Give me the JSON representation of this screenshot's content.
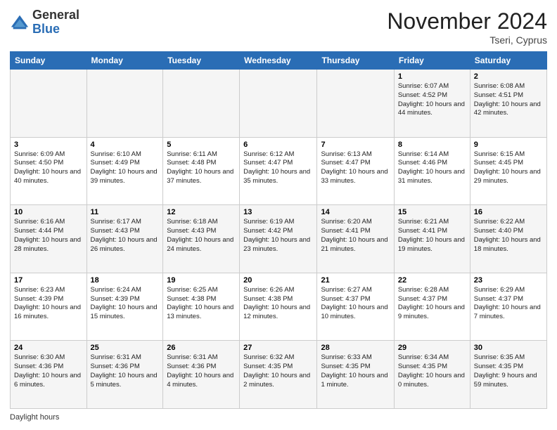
{
  "logo": {
    "general": "General",
    "blue": "Blue"
  },
  "header": {
    "month_year": "November 2024",
    "location": "Tseri, Cyprus"
  },
  "days_of_week": [
    "Sunday",
    "Monday",
    "Tuesday",
    "Wednesday",
    "Thursday",
    "Friday",
    "Saturday"
  ],
  "footer": {
    "daylight_label": "Daylight hours"
  },
  "weeks": [
    [
      {
        "day": "",
        "info": ""
      },
      {
        "day": "",
        "info": ""
      },
      {
        "day": "",
        "info": ""
      },
      {
        "day": "",
        "info": ""
      },
      {
        "day": "",
        "info": ""
      },
      {
        "day": "1",
        "info": "Sunrise: 6:07 AM\nSunset: 4:52 PM\nDaylight: 10 hours and 44 minutes."
      },
      {
        "day": "2",
        "info": "Sunrise: 6:08 AM\nSunset: 4:51 PM\nDaylight: 10 hours and 42 minutes."
      }
    ],
    [
      {
        "day": "3",
        "info": "Sunrise: 6:09 AM\nSunset: 4:50 PM\nDaylight: 10 hours and 40 minutes."
      },
      {
        "day": "4",
        "info": "Sunrise: 6:10 AM\nSunset: 4:49 PM\nDaylight: 10 hours and 39 minutes."
      },
      {
        "day": "5",
        "info": "Sunrise: 6:11 AM\nSunset: 4:48 PM\nDaylight: 10 hours and 37 minutes."
      },
      {
        "day": "6",
        "info": "Sunrise: 6:12 AM\nSunset: 4:47 PM\nDaylight: 10 hours and 35 minutes."
      },
      {
        "day": "7",
        "info": "Sunrise: 6:13 AM\nSunset: 4:47 PM\nDaylight: 10 hours and 33 minutes."
      },
      {
        "day": "8",
        "info": "Sunrise: 6:14 AM\nSunset: 4:46 PM\nDaylight: 10 hours and 31 minutes."
      },
      {
        "day": "9",
        "info": "Sunrise: 6:15 AM\nSunset: 4:45 PM\nDaylight: 10 hours and 29 minutes."
      }
    ],
    [
      {
        "day": "10",
        "info": "Sunrise: 6:16 AM\nSunset: 4:44 PM\nDaylight: 10 hours and 28 minutes."
      },
      {
        "day": "11",
        "info": "Sunrise: 6:17 AM\nSunset: 4:43 PM\nDaylight: 10 hours and 26 minutes."
      },
      {
        "day": "12",
        "info": "Sunrise: 6:18 AM\nSunset: 4:43 PM\nDaylight: 10 hours and 24 minutes."
      },
      {
        "day": "13",
        "info": "Sunrise: 6:19 AM\nSunset: 4:42 PM\nDaylight: 10 hours and 23 minutes."
      },
      {
        "day": "14",
        "info": "Sunrise: 6:20 AM\nSunset: 4:41 PM\nDaylight: 10 hours and 21 minutes."
      },
      {
        "day": "15",
        "info": "Sunrise: 6:21 AM\nSunset: 4:41 PM\nDaylight: 10 hours and 19 minutes."
      },
      {
        "day": "16",
        "info": "Sunrise: 6:22 AM\nSunset: 4:40 PM\nDaylight: 10 hours and 18 minutes."
      }
    ],
    [
      {
        "day": "17",
        "info": "Sunrise: 6:23 AM\nSunset: 4:39 PM\nDaylight: 10 hours and 16 minutes."
      },
      {
        "day": "18",
        "info": "Sunrise: 6:24 AM\nSunset: 4:39 PM\nDaylight: 10 hours and 15 minutes."
      },
      {
        "day": "19",
        "info": "Sunrise: 6:25 AM\nSunset: 4:38 PM\nDaylight: 10 hours and 13 minutes."
      },
      {
        "day": "20",
        "info": "Sunrise: 6:26 AM\nSunset: 4:38 PM\nDaylight: 10 hours and 12 minutes."
      },
      {
        "day": "21",
        "info": "Sunrise: 6:27 AM\nSunset: 4:37 PM\nDaylight: 10 hours and 10 minutes."
      },
      {
        "day": "22",
        "info": "Sunrise: 6:28 AM\nSunset: 4:37 PM\nDaylight: 10 hours and 9 minutes."
      },
      {
        "day": "23",
        "info": "Sunrise: 6:29 AM\nSunset: 4:37 PM\nDaylight: 10 hours and 7 minutes."
      }
    ],
    [
      {
        "day": "24",
        "info": "Sunrise: 6:30 AM\nSunset: 4:36 PM\nDaylight: 10 hours and 6 minutes."
      },
      {
        "day": "25",
        "info": "Sunrise: 6:31 AM\nSunset: 4:36 PM\nDaylight: 10 hours and 5 minutes."
      },
      {
        "day": "26",
        "info": "Sunrise: 6:31 AM\nSunset: 4:36 PM\nDaylight: 10 hours and 4 minutes."
      },
      {
        "day": "27",
        "info": "Sunrise: 6:32 AM\nSunset: 4:35 PM\nDaylight: 10 hours and 2 minutes."
      },
      {
        "day": "28",
        "info": "Sunrise: 6:33 AM\nSunset: 4:35 PM\nDaylight: 10 hours and 1 minute."
      },
      {
        "day": "29",
        "info": "Sunrise: 6:34 AM\nSunset: 4:35 PM\nDaylight: 10 hours and 0 minutes."
      },
      {
        "day": "30",
        "info": "Sunrise: 6:35 AM\nSunset: 4:35 PM\nDaylight: 9 hours and 59 minutes."
      }
    ]
  ]
}
